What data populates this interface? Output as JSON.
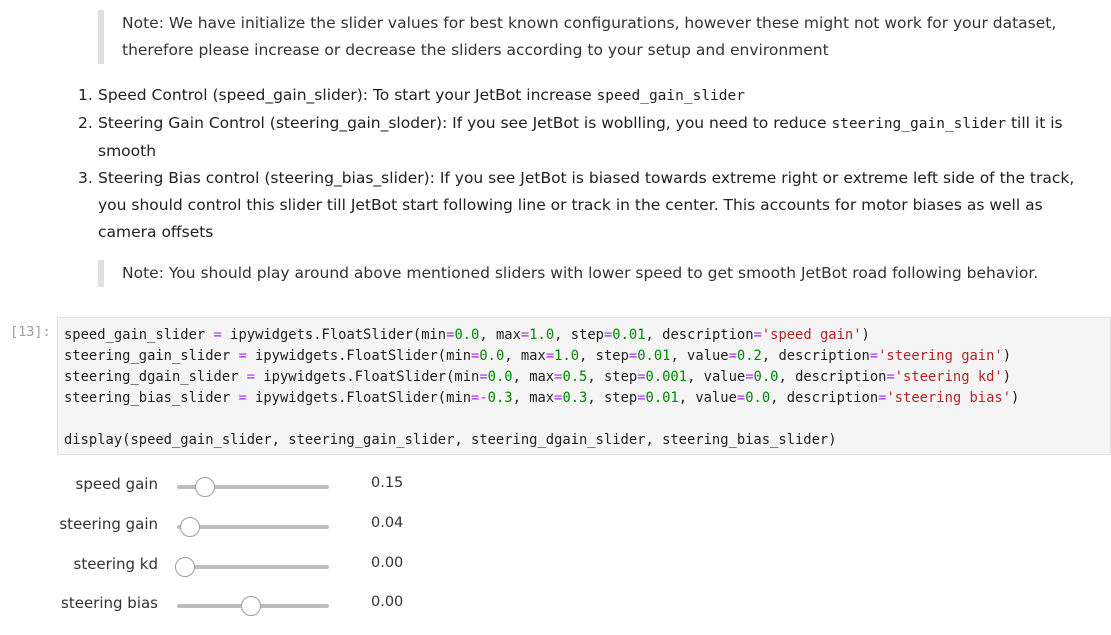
{
  "notes": {
    "note1": "Note: We have initialize the slider values for best known configurations, however these might not work for your dataset, therefore please increase or decrease the sliders according to your setup and environment",
    "note2": "Note: You should play around above mentioned sliders with lower speed to get smooth JetBot road following behavior."
  },
  "steps": [
    {
      "num": "1.",
      "text": "Speed Control (speed_gain_slider): To start your JetBot increase ",
      "code": "speed_gain_slider",
      "tail": ""
    },
    {
      "num": "2.",
      "text": "Steering Gain Control (steering_gain_sloder): If you see JetBot is woblling, you need to reduce ",
      "code": "steering_gain_slider",
      "tail": " till it is smooth"
    },
    {
      "num": "3.",
      "text": "Steering Bias control (steering_bias_slider): If you see JetBot is biased towards extreme right or extreme left side of the track, you should control this slider till JetBot start following line or track in the center. This accounts for motor biases as well as camera offsets",
      "code": "",
      "tail": ""
    }
  ],
  "cell": {
    "prompt": "[13]:",
    "lines": [
      "speed_gain_slider = ipywidgets.FloatSlider(min=0.0, max=1.0, step=0.01, description='speed gain')",
      "steering_gain_slider = ipywidgets.FloatSlider(min=0.0, max=1.0, step=0.01, value=0.2, description='steering gain')",
      "steering_dgain_slider = ipywidgets.FloatSlider(min=0.0, max=0.5, step=0.001, value=0.0, description='steering kd')",
      "steering_bias_slider = ipywidgets.FloatSlider(min=-0.3, max=0.3, step=0.01, value=0.0, description='steering bias')",
      "",
      "display(speed_gain_slider, steering_gain_slider, steering_dgain_slider, steering_bias_slider)"
    ]
  },
  "sliders": [
    {
      "label": "speed gain",
      "value": "0.15",
      "fraction": 0.15
    },
    {
      "label": "steering gain",
      "value": "0.04",
      "fraction": 0.04
    },
    {
      "label": "steering kd",
      "value": "0.00",
      "fraction": 0.0
    },
    {
      "label": "steering bias",
      "value": "0.00",
      "fraction": 0.5
    }
  ]
}
